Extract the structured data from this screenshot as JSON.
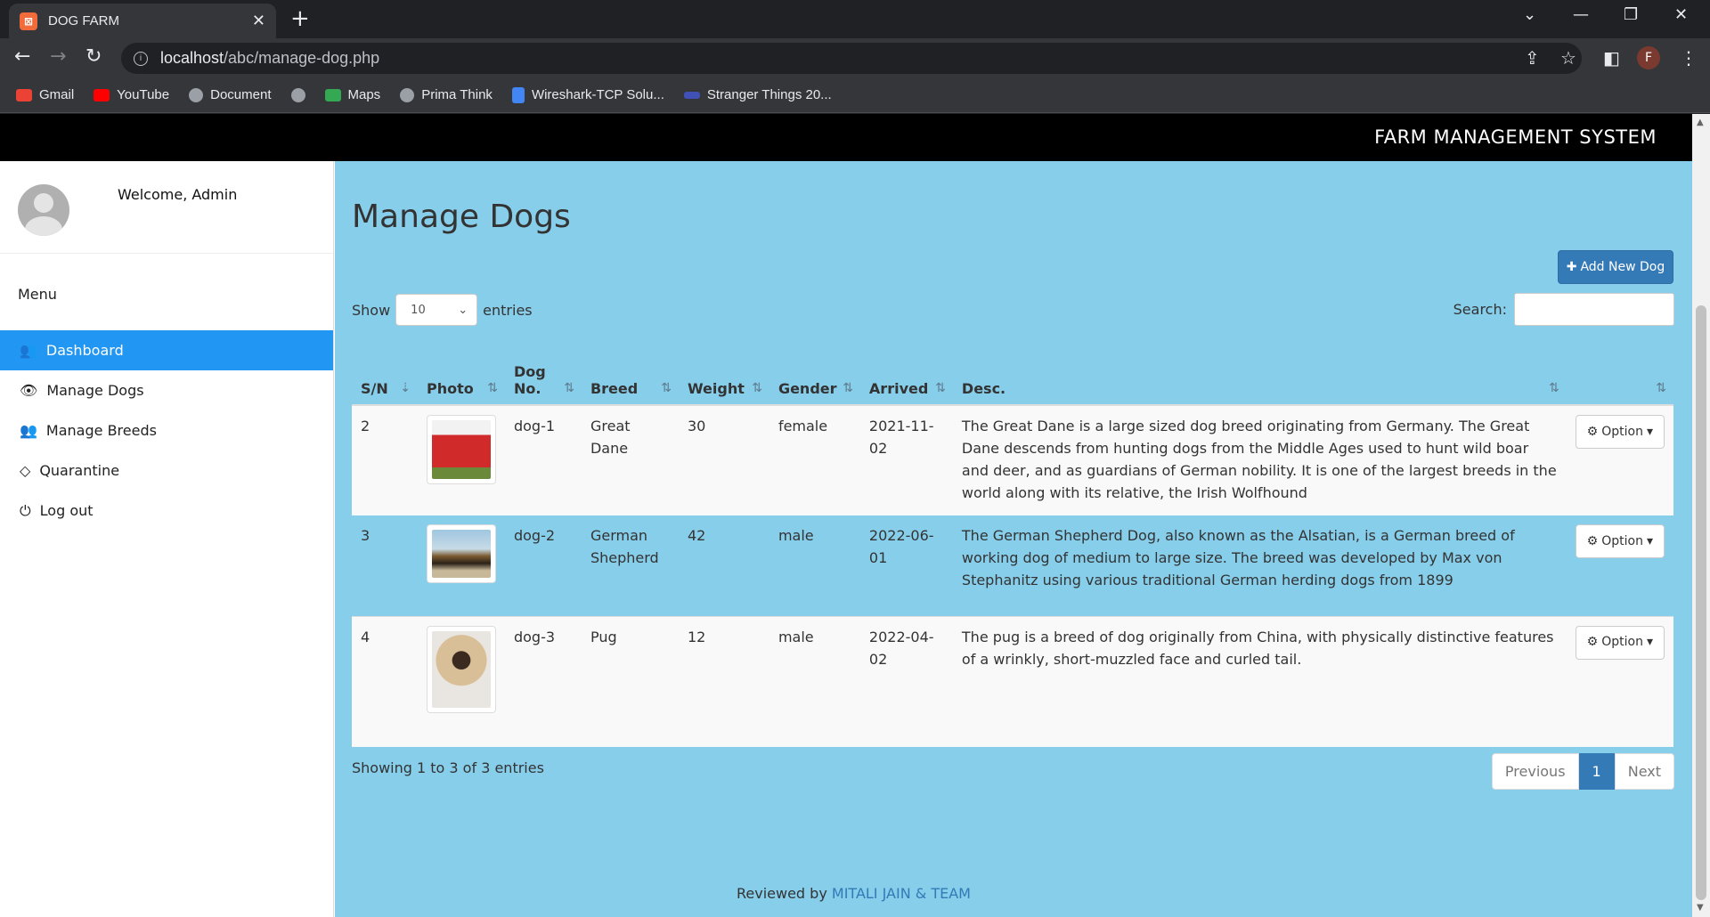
{
  "browser": {
    "tab_title": "DOG FARM",
    "url_host": "localhost",
    "url_path": "/abc/manage-dog.php",
    "profile_initial": "F",
    "bookmarks": [
      {
        "label": "Gmail",
        "icon": "gmail-icon",
        "color": "#ea4335"
      },
      {
        "label": "YouTube",
        "icon": "youtube-icon",
        "color": "#ff0000"
      },
      {
        "label": "Document",
        "icon": "globe-icon",
        "color": "#9aa0a6"
      },
      {
        "label": "",
        "icon": "globe-icon",
        "color": "#9aa0a6"
      },
      {
        "label": "Maps",
        "icon": "maps-icon",
        "color": "#34a853"
      },
      {
        "label": "Prima Think",
        "icon": "globe-icon",
        "color": "#9aa0a6"
      },
      {
        "label": "Wireshark-TCP Solu...",
        "icon": "docs-icon",
        "color": "#4285f4"
      },
      {
        "label": "Stranger Things 20...",
        "icon": "site-icon",
        "color": "#3f51b5"
      }
    ]
  },
  "header": {
    "system_name": "FARM MANAGEMENT SYSTEM"
  },
  "sidebar": {
    "welcome": "Welcome, Admin",
    "menu_title": "Menu",
    "items": [
      {
        "label": "Dashboard",
        "icon": "users-icon",
        "active": true
      },
      {
        "label": "Manage Dogs",
        "icon": "eye-icon",
        "active": false
      },
      {
        "label": "Manage Breeds",
        "icon": "users-icon",
        "active": false
      },
      {
        "label": "Quarantine",
        "icon": "diamond-icon",
        "active": false
      },
      {
        "label": "Log out",
        "icon": "power-icon",
        "active": false
      }
    ]
  },
  "main": {
    "title": "Manage Dogs",
    "add_button": "Add New Dog",
    "show_label": "Show",
    "entries_value": "10",
    "entries_label": "entries",
    "search_label": "Search:",
    "columns": [
      "S/N",
      "Photo",
      "Dog No.",
      "Breed",
      "Weight",
      "Gender",
      "Arrived",
      "Desc.",
      ""
    ],
    "rows": [
      {
        "sn": "2",
        "photo": "dog-1-photo",
        "dog_no": "dog-1",
        "breed": "Great Dane",
        "weight": "30",
        "gender": "female",
        "arrived": "2021-11-02",
        "desc": "The Great Dane is a large sized dog breed originating from Germany. The Great Dane descends from hunting dogs from the Middle Ages used to hunt wild boar and deer, and as guardians of German nobility. It is one of the largest breeds in the world along with its relative, the Irish Wolfhound",
        "option": "Option"
      },
      {
        "sn": "3",
        "photo": "dog-2-photo",
        "dog_no": "dog-2",
        "breed": "German Shepherd",
        "weight": "42",
        "gender": "male",
        "arrived": "2022-06-01",
        "desc": "The German Shepherd Dog, also known as the Alsatian, is a German breed of working dog of medium to large size. The breed was developed by Max von Stephanitz using various traditional German herding dogs from 1899",
        "option": "Option"
      },
      {
        "sn": "4",
        "photo": "dog-3-photo",
        "dog_no": "dog-3",
        "breed": "Pug",
        "weight": "12",
        "gender": "male",
        "arrived": "2022-04-02",
        "desc": "The pug is a breed of dog originally from China, with physically distinctive features of a wrinkly, short-muzzled face and curled tail.",
        "option": "Option"
      }
    ],
    "info": "Showing 1 to 3 of 3 entries",
    "pager": {
      "prev": "Previous",
      "current": "1",
      "next": "Next"
    },
    "footer_prefix": "Reviewed by ",
    "footer_team": "MITALI JAIN & TEAM"
  }
}
